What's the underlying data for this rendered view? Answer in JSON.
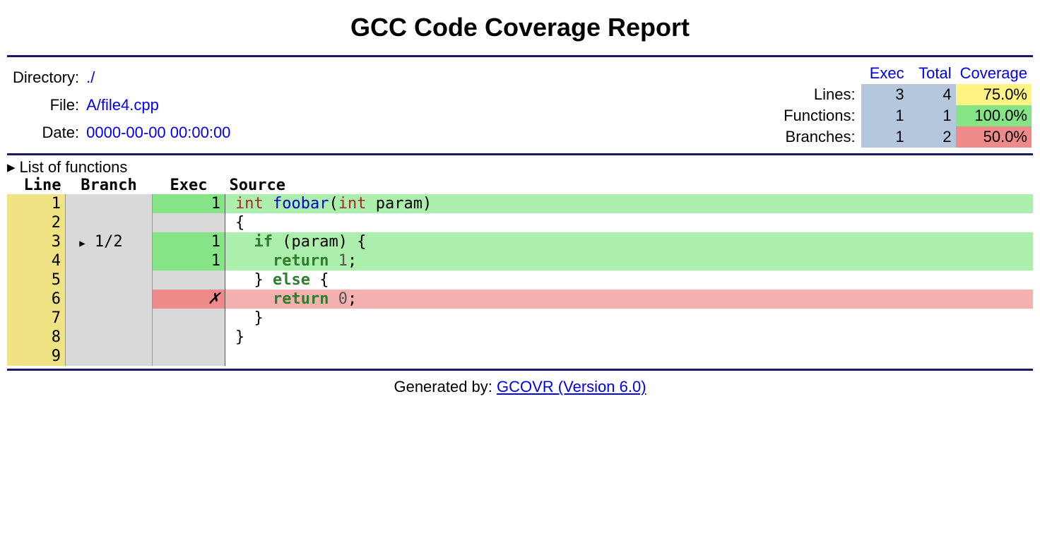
{
  "title": "GCC Code Coverage Report",
  "meta": {
    "directory_label": "Directory:",
    "directory_value": "./",
    "file_label": "File:",
    "file_value": "A/file4.cpp",
    "date_label": "Date:",
    "date_value": "0000-00-00 00:00:00"
  },
  "summary": {
    "headers": {
      "exec": "Exec",
      "total": "Total",
      "coverage": "Coverage"
    },
    "rows": {
      "lines": {
        "label": "Lines:",
        "exec": "3",
        "total": "4",
        "coverage": "75.0%",
        "klass": "cov-yellow"
      },
      "functions": {
        "label": "Functions:",
        "exec": "1",
        "total": "1",
        "coverage": "100.0%",
        "klass": "cov-green"
      },
      "branches": {
        "label": "Branches:",
        "exec": "1",
        "total": "2",
        "coverage": "50.0%",
        "klass": "cov-red"
      }
    }
  },
  "functions_toggle": "List of functions",
  "columns": {
    "line": "Line",
    "branch": "Branch",
    "exec": "Exec",
    "source": "Source"
  },
  "source_rows": [
    {
      "n": "1",
      "branch": "",
      "exec": "1",
      "status": "hit",
      "src_html": "<span class='type'>int</span> <span class='fn'>foobar</span>(<span class='type'>int</span> param)"
    },
    {
      "n": "2",
      "branch": "",
      "exec": "",
      "status": "",
      "src_html": "{"
    },
    {
      "n": "3",
      "branch": "▸ 1/2",
      "exec": "1",
      "status": "hit",
      "src_html": "  <span class='kw'>if</span> (param) {"
    },
    {
      "n": "4",
      "branch": "",
      "exec": "1",
      "status": "hit",
      "src_html": "    <span class='kw'>return</span> <span class='num'>1</span>;"
    },
    {
      "n": "5",
      "branch": "",
      "exec": "",
      "status": "",
      "src_html": "  } <span class='kw'>else</span> {"
    },
    {
      "n": "6",
      "branch": "",
      "exec": "✗",
      "status": "miss",
      "src_html": "    <span class='kw'>return</span> <span class='num'>0</span>;"
    },
    {
      "n": "7",
      "branch": "",
      "exec": "",
      "status": "",
      "src_html": "  }"
    },
    {
      "n": "8",
      "branch": "",
      "exec": "",
      "status": "",
      "src_html": "}"
    },
    {
      "n": "9",
      "branch": "",
      "exec": "",
      "status": "",
      "src_html": ""
    }
  ],
  "footer": {
    "prefix": "Generated by: ",
    "link": "GCOVR (Version 6.0)"
  }
}
